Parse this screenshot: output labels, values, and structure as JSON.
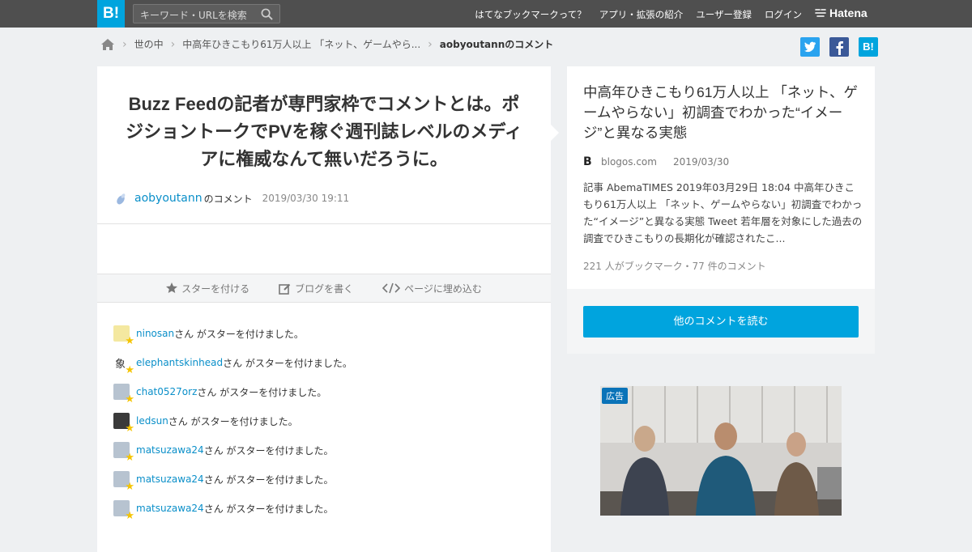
{
  "header": {
    "logo": "B!",
    "search_placeholder": "キーワード・URLを検索",
    "nav": [
      "はてなブックマークって？",
      "アプリ・拡張の紹介",
      "ユーザー登録",
      "ログイン"
    ],
    "hatena": "Hatena"
  },
  "breadcrumb": {
    "items": [
      "世の中",
      "中高年ひきこもり61万人以上 「ネット、ゲームやら...",
      "aobyoutannのコメント"
    ]
  },
  "share": [
    "twitter-icon",
    "facebook-icon",
    "hatena-bookmark-icon"
  ],
  "comment": {
    "title": "Buzz Feedの記者が専門家枠でコメントとは。ポジショントークでPVを稼ぐ週刊誌レベルのメディアに権威なんて無いだろうに。",
    "user": "aobyoutann",
    "user_suffix": "のコメント",
    "timestamp": "2019/03/30 19:11"
  },
  "actions": {
    "star": "スターを付ける",
    "blog": "ブログを書く",
    "embed": "ページに埋め込む"
  },
  "stars": {
    "suffix": "さん がスターを付けました。",
    "users": [
      "ninosan",
      "elephantskinhead",
      "chat0527orz",
      "ledsun",
      "matsuzawa24",
      "matsuzawa24",
      "matsuzawa24"
    ]
  },
  "entry": {
    "title": "中高年ひきこもり61万人以上 「ネット、ゲームやらない」初調査でわかった“イメージ”と異なる実態",
    "source_icon": "B",
    "source": "blogos.com",
    "date": "2019/03/30",
    "summary": "記事 AbemaTIMES 2019年03月29日 18:04 中高年ひきこもり61万人以上 「ネット、ゲームやらない」初調査でわかった“イメージ”と異なる実態 Tweet 若年層を対象にした過去の調査でひきこもりの長期化が確認されたこ...",
    "counts": "221 人がブックマーク・77 件のコメント",
    "read_button": "他のコメントを読む"
  },
  "ad": {
    "label": "広告"
  }
}
